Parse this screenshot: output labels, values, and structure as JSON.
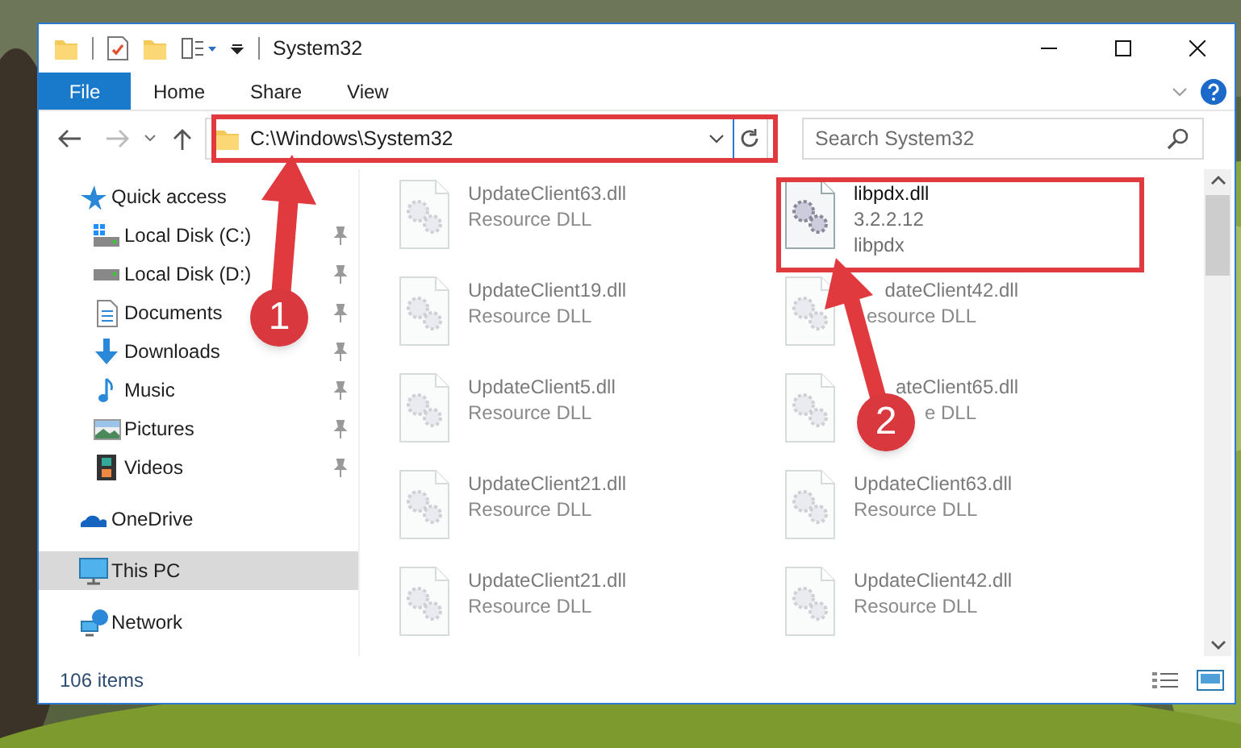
{
  "window": {
    "title": "System32"
  },
  "ribbon": {
    "tabs": [
      {
        "label": "File",
        "kind": "file",
        "selected": false
      },
      {
        "label": "Home",
        "kind": "tab",
        "selected": false
      },
      {
        "label": "Share",
        "kind": "tab",
        "selected": false
      },
      {
        "label": "View",
        "kind": "tab",
        "selected": false
      }
    ]
  },
  "address_bar": {
    "path": "C:\\Windows\\System32"
  },
  "search": {
    "placeholder": "Search System32"
  },
  "sidebar": {
    "items": [
      {
        "label": "Quick access",
        "selected": false,
        "children": [
          {
            "label": "Local Disk (C:)",
            "pinned": true,
            "selected": false
          },
          {
            "label": "Local Disk (D:)",
            "pinned": true,
            "selected": false
          },
          {
            "label": "Documents",
            "pinned": true,
            "selected": false
          },
          {
            "label": "Downloads",
            "pinned": true,
            "selected": false
          },
          {
            "label": "Music",
            "pinned": true,
            "selected": false
          },
          {
            "label": "Pictures",
            "pinned": true,
            "selected": false
          },
          {
            "label": "Videos",
            "pinned": true,
            "selected": false
          }
        ]
      },
      {
        "label": "OneDrive",
        "selected": false
      },
      {
        "label": "This PC",
        "selected": true
      },
      {
        "label": "Network",
        "selected": false
      }
    ]
  },
  "files": [
    {
      "name": "UpdateClient63.dll",
      "details": [
        "Resource DLL"
      ],
      "faded": true,
      "covered": false
    },
    {
      "name": "libpdx.dll",
      "details": [
        "3.2.2.12",
        "libpdx"
      ],
      "faded": false,
      "covered": false
    },
    {
      "name": "UpdateClient19.dll",
      "details": [
        "Resource DLL"
      ],
      "faded": true,
      "covered": false
    },
    {
      "name": "dateClient42.dll",
      "details": [
        "esource DLL"
      ],
      "faded": true,
      "covered": true
    },
    {
      "name": "UpdateClient5.dll",
      "details": [
        "Resource DLL"
      ],
      "faded": true,
      "covered": false
    },
    {
      "name": "ateClient65.dll",
      "details": [
        "e DLL"
      ],
      "faded": true,
      "covered": true
    },
    {
      "name": "UpdateClient21.dll",
      "details": [
        "Resource DLL"
      ],
      "faded": true,
      "covered": false
    },
    {
      "name": "UpdateClient63.dll",
      "details": [
        "Resource DLL"
      ],
      "faded": true,
      "covered": false
    },
    {
      "name": "UpdateClient21.dll",
      "details": [
        "Resource DLL"
      ],
      "faded": true,
      "covered": false
    },
    {
      "name": "UpdateClient42.dll",
      "details": [
        "Resource DLL"
      ],
      "faded": true,
      "covered": false
    }
  ],
  "callouts": [
    {
      "number": "1"
    },
    {
      "number": "2"
    }
  ],
  "status_bar": {
    "item_count": "106 items"
  }
}
